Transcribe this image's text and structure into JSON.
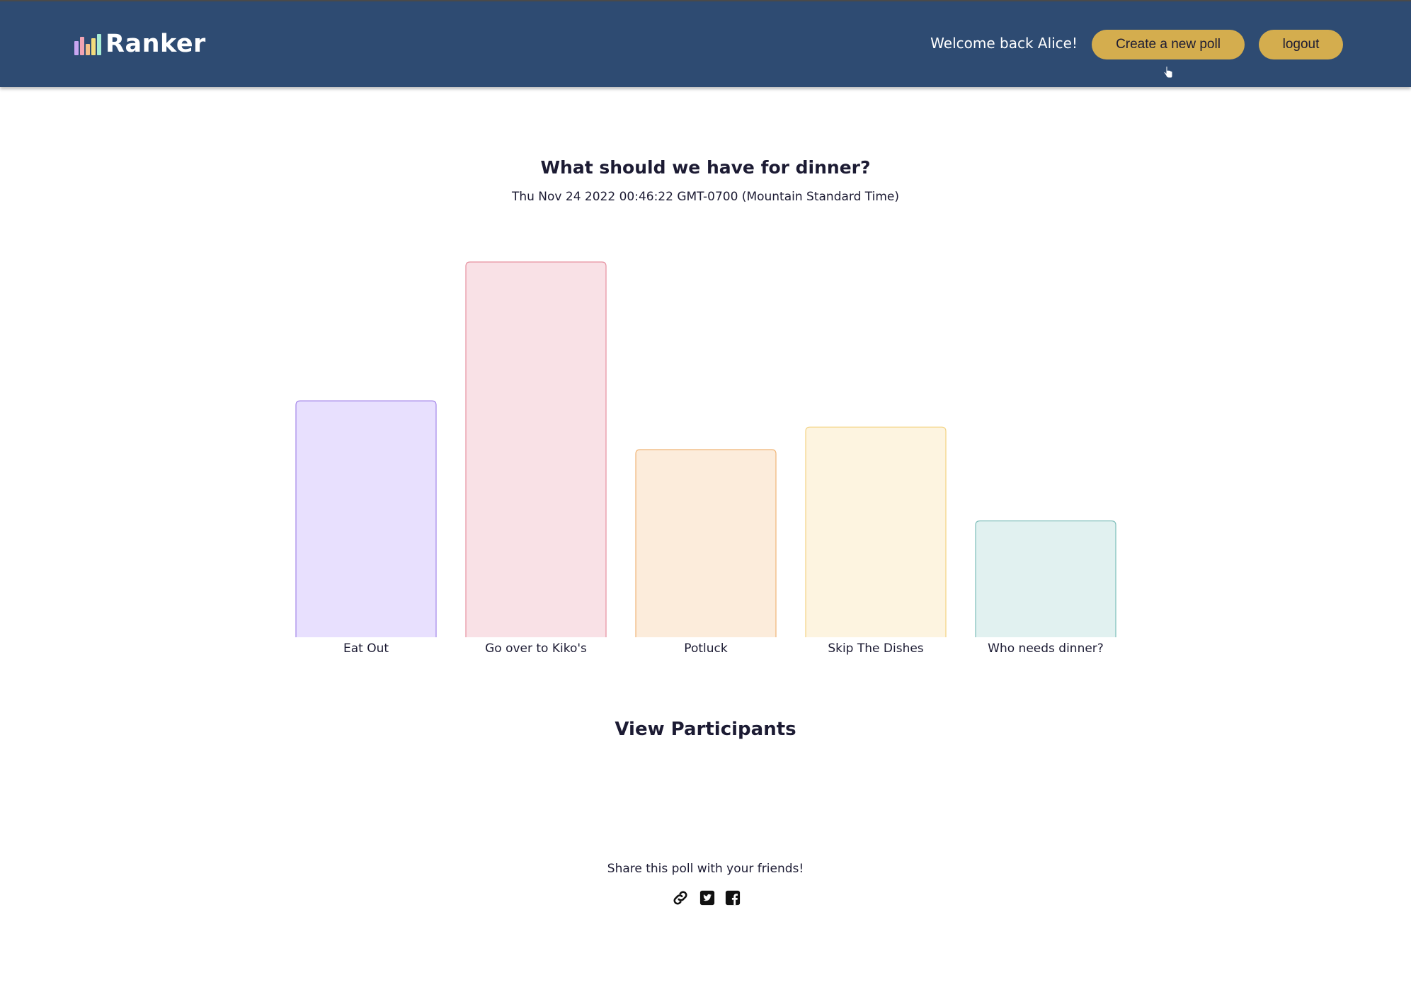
{
  "header": {
    "logo_text": "Ranker",
    "logo_icon": "bar-chart-icon",
    "welcome_text": "Welcome back Alice!",
    "create_button": "Create a new poll",
    "logout_button": "logout",
    "background_color": "#2e4b72",
    "button_color": "#d4ad4e"
  },
  "poll": {
    "title": "What should we have for dinner?",
    "date": "Thu Nov 24 2022 00:46:22 GMT-0700 (Mountain Standard Time)"
  },
  "chart_data": {
    "type": "bar",
    "categories": [
      "Eat Out",
      "Go over to Kiko's",
      "Potluck",
      "Skip The Dishes",
      "Who needs dinner?"
    ],
    "values": [
      0.63,
      1.0,
      0.5,
      0.56,
      0.31
    ],
    "title": "",
    "xlabel": "",
    "ylabel": "",
    "ylim": [
      0,
      1
    ],
    "grid": false,
    "colors": [
      {
        "fill": "#e8e0fe",
        "stroke": "#a486e8"
      },
      {
        "fill": "#f9e1e6",
        "stroke": "#e6909f"
      },
      {
        "fill": "#fcecdb",
        "stroke": "#f0b577"
      },
      {
        "fill": "#fdf4e0",
        "stroke": "#f3d382"
      },
      {
        "fill": "#e1f1f0",
        "stroke": "#7dbdb9"
      }
    ]
  },
  "participants": {
    "title": "View Participants"
  },
  "share": {
    "text": "Share this poll with your friends!",
    "icons": [
      "link-icon",
      "twitter-icon",
      "facebook-icon"
    ]
  }
}
